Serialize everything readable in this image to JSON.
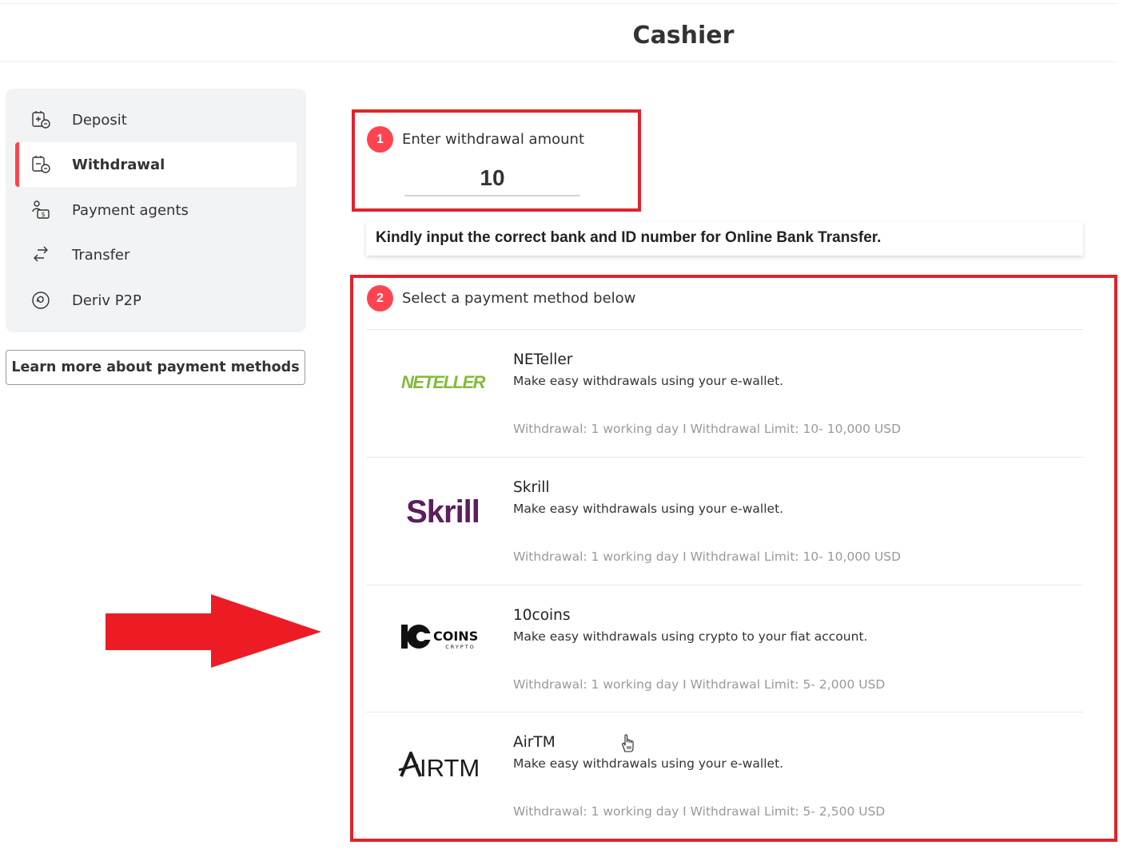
{
  "header": {
    "title": "Cashier"
  },
  "sidebar": {
    "items": [
      {
        "label": "Deposit",
        "icon": "deposit-icon",
        "active": false
      },
      {
        "label": "Withdrawal",
        "icon": "withdrawal-icon",
        "active": true
      },
      {
        "label": "Payment agents",
        "icon": "payment-agents-icon",
        "active": false
      },
      {
        "label": "Transfer",
        "icon": "transfer-icon",
        "active": false
      },
      {
        "label": "Deriv P2P",
        "icon": "p2p-icon",
        "active": false
      }
    ],
    "learn_more_label": "Learn more about payment methods"
  },
  "step1": {
    "number": "1",
    "label": "Enter withdrawal amount",
    "amount": "10"
  },
  "notice": "Kindly input the correct bank and ID number for Online Bank Transfer.",
  "step2": {
    "number": "2",
    "label": "Select a payment method below"
  },
  "methods": [
    {
      "name": "NETeller",
      "logo_text": "NETELLER",
      "logo_color": "#83ba3b",
      "description": "Make easy withdrawals using your e-wallet.",
      "info": "Withdrawal: 1 working day I Withdrawal Limit: 10- 10,000 USD"
    },
    {
      "name": "Skrill",
      "logo_text": "Skrill",
      "logo_color": "#5c1e5c",
      "description": "Make easy withdrawals using your e-wallet.",
      "info": "Withdrawal: 1 working day I Withdrawal Limit: 10- 10,000 USD"
    },
    {
      "name": "10coins",
      "logo_text": "COINS",
      "logo_subtext": "CRYPTO",
      "logo_color": "#111111",
      "description": "Make easy withdrawals using crypto to your fiat account.",
      "info": "Withdrawal: 1 working day I Withdrawal Limit: 5- 2,000 USD"
    },
    {
      "name": "AirTM",
      "logo_text": "IRTM",
      "logo_color": "#1a1a1a",
      "description": "Make easy withdrawals using your e-wallet.",
      "info": "Withdrawal: 1 working day I Withdrawal Limit: 5- 2,500 USD"
    }
  ],
  "colors": {
    "accent": "#ff444f",
    "annotation": "#e0232c",
    "sidebar_bg": "#f2f3f4"
  }
}
